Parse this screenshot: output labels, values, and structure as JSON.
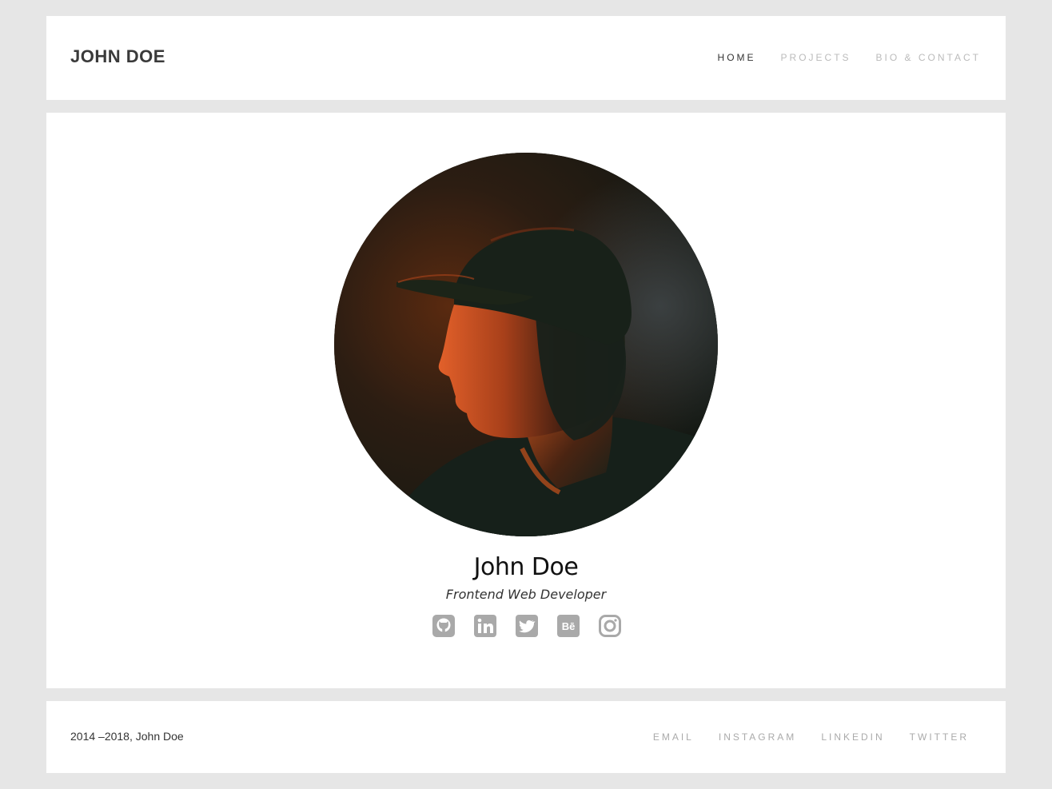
{
  "header": {
    "brand": "JOHN DOE",
    "nav": [
      {
        "label": "HOME",
        "active": true
      },
      {
        "label": "PROJECTS",
        "active": false
      },
      {
        "label": "BIO & CONTACT",
        "active": false
      }
    ]
  },
  "profile": {
    "name": "John Doe",
    "role": "Frontend Web Developer",
    "photo_icon": "profile-photo",
    "socials": [
      {
        "icon": "github-icon"
      },
      {
        "icon": "linkedin-icon"
      },
      {
        "icon": "twitter-icon"
      },
      {
        "icon": "behance-icon"
      },
      {
        "icon": "instagram-icon"
      }
    ]
  },
  "footer": {
    "copyright": "2014 –2018, John Doe",
    "links": [
      "EMAIL",
      "INSTAGRAM",
      "LINKEDIN",
      "TWITTER"
    ]
  },
  "colors": {
    "page_background": "#e6e6e6",
    "panel_background": "#ffffff",
    "nav_active": "#333333",
    "nav_inactive": "#bbbbbb",
    "icon_gray": "#a9a9a9"
  }
}
